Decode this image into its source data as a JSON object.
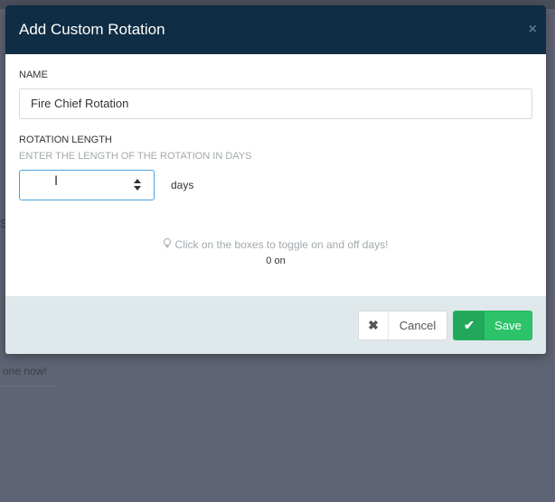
{
  "background": {
    "snippet_text": "one now!",
    "snippet_s": "S"
  },
  "modal": {
    "title": "Add Custom Rotation",
    "close_glyph": "×",
    "name_label": "NAME",
    "name_value": "Fire Chief Rotation",
    "rotation_length_label": "ROTATION LENGTH",
    "rotation_length_hint": "ENTER THE LENGTH OF THE ROTATION IN DAYS",
    "rotation_length_value": "",
    "days_label": "days",
    "toggle_hint": "Click on the boxes to toggle on and off days!",
    "on_count": "0 on",
    "cancel_label": "Cancel",
    "save_label": "Save"
  },
  "colors": {
    "header_bg": "#0f2d44",
    "footer_bg": "#dfe8ea",
    "save_green": "#2cc36b",
    "input_focus": "#4aa3df"
  },
  "icons": {
    "close": "close-icon",
    "bulb": "lightbulb-icon",
    "cancel": "x-icon",
    "save": "check-icon",
    "spinner": "spinner-arrows-icon"
  }
}
